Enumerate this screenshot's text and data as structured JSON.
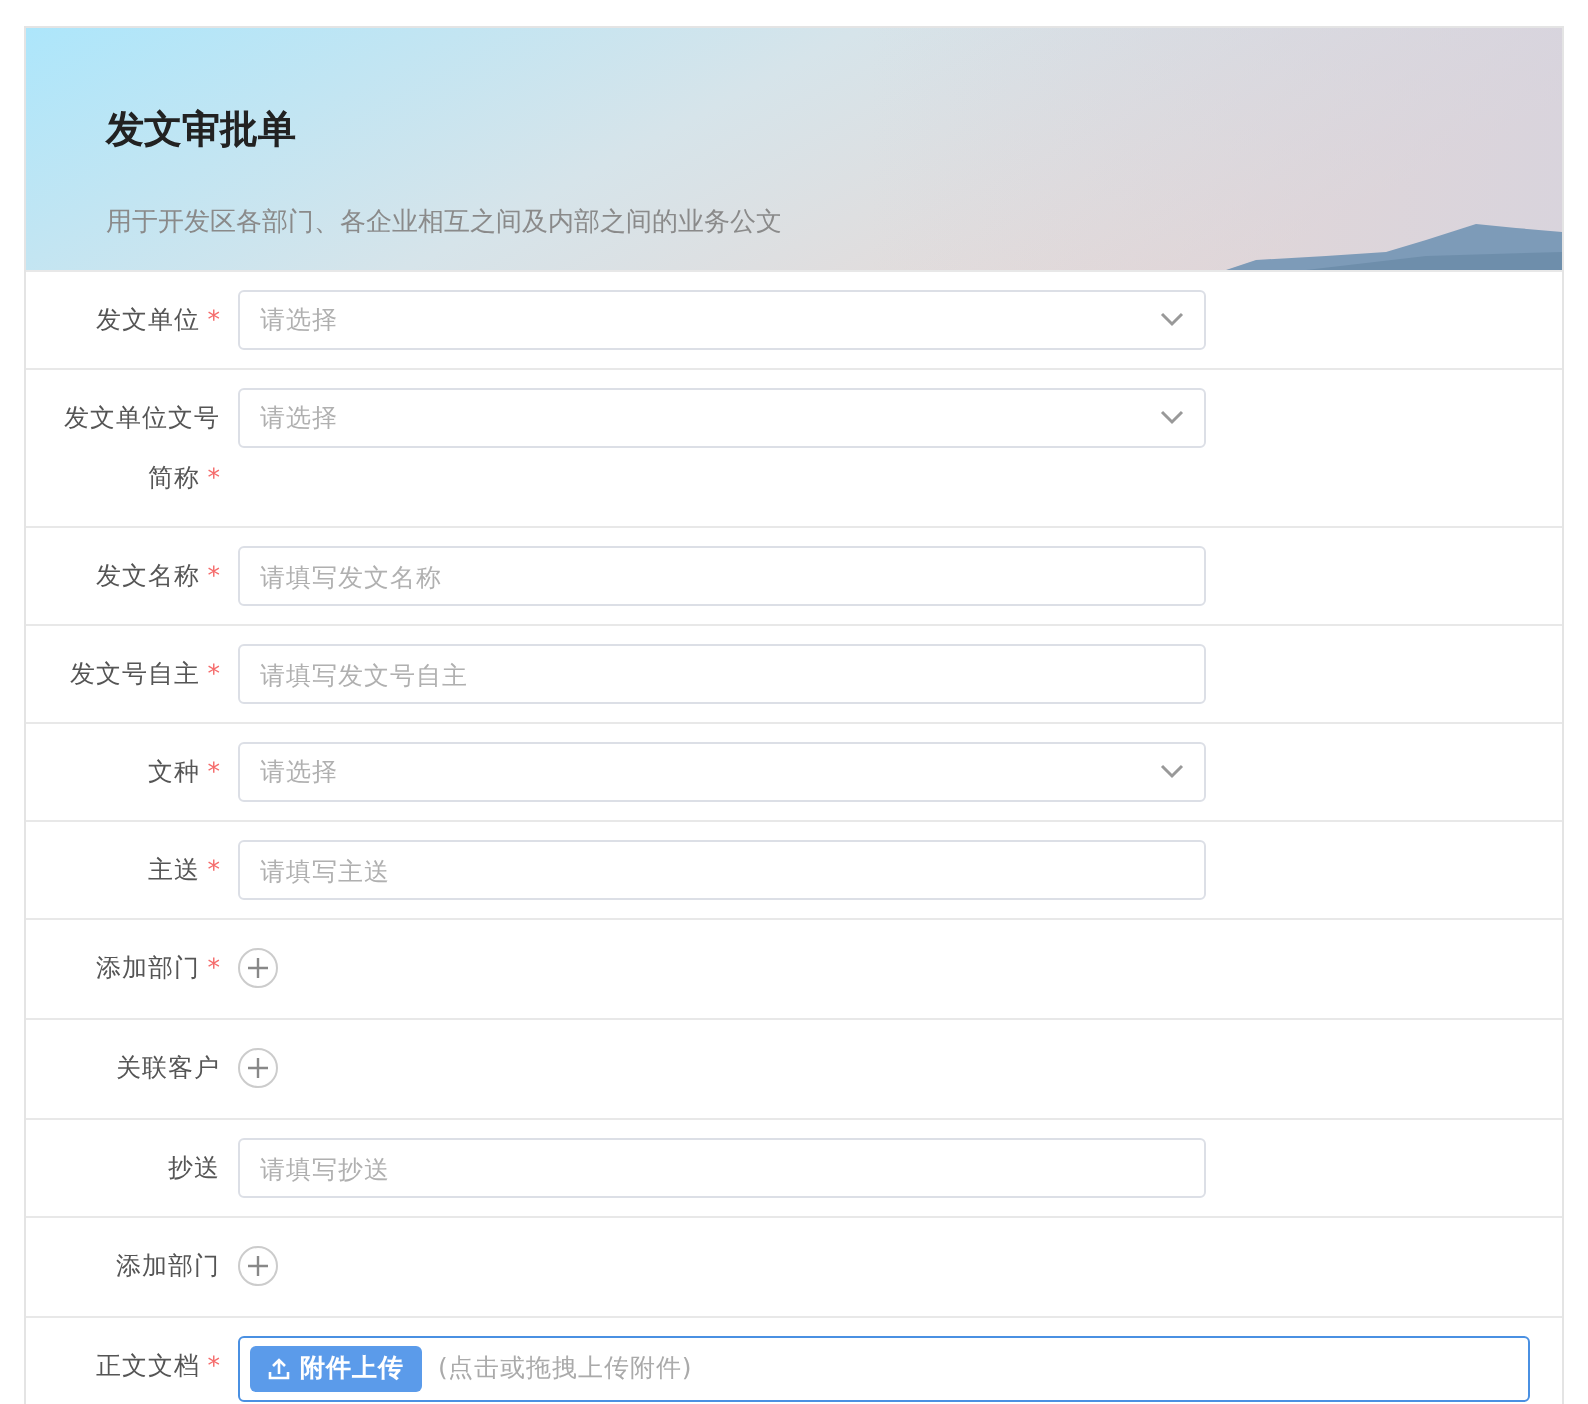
{
  "header": {
    "title": "发文审批单",
    "subtitle": "用于开发区各部门、各企业相互之间及内部之间的业务公文"
  },
  "required_mark": "*",
  "fields": [
    {
      "kind": "select",
      "label": "发文单位",
      "required": true,
      "placeholder": "请选择"
    },
    {
      "kind": "select",
      "label": "发文单位文号简称",
      "required": true,
      "placeholder": "请选择"
    },
    {
      "kind": "input",
      "label": "发文名称",
      "required": true,
      "placeholder": "请填写发文名称"
    },
    {
      "kind": "input",
      "label": "发文号自主",
      "required": true,
      "placeholder": "请填写发文号自主"
    },
    {
      "kind": "select",
      "label": "文种",
      "required": true,
      "placeholder": "请选择"
    },
    {
      "kind": "input",
      "label": "主送",
      "required": true,
      "placeholder": "请填写主送"
    },
    {
      "kind": "add",
      "label": "添加部门",
      "required": true
    },
    {
      "kind": "add",
      "label": "关联客户",
      "required": false
    },
    {
      "kind": "input",
      "label": "抄送",
      "required": false,
      "placeholder": "请填写抄送"
    },
    {
      "kind": "add",
      "label": "添加部门",
      "required": false
    },
    {
      "kind": "upload",
      "label": "正文文档",
      "required": true,
      "button": "附件上传",
      "hint": "(点击或拖拽上传附件)"
    }
  ]
}
